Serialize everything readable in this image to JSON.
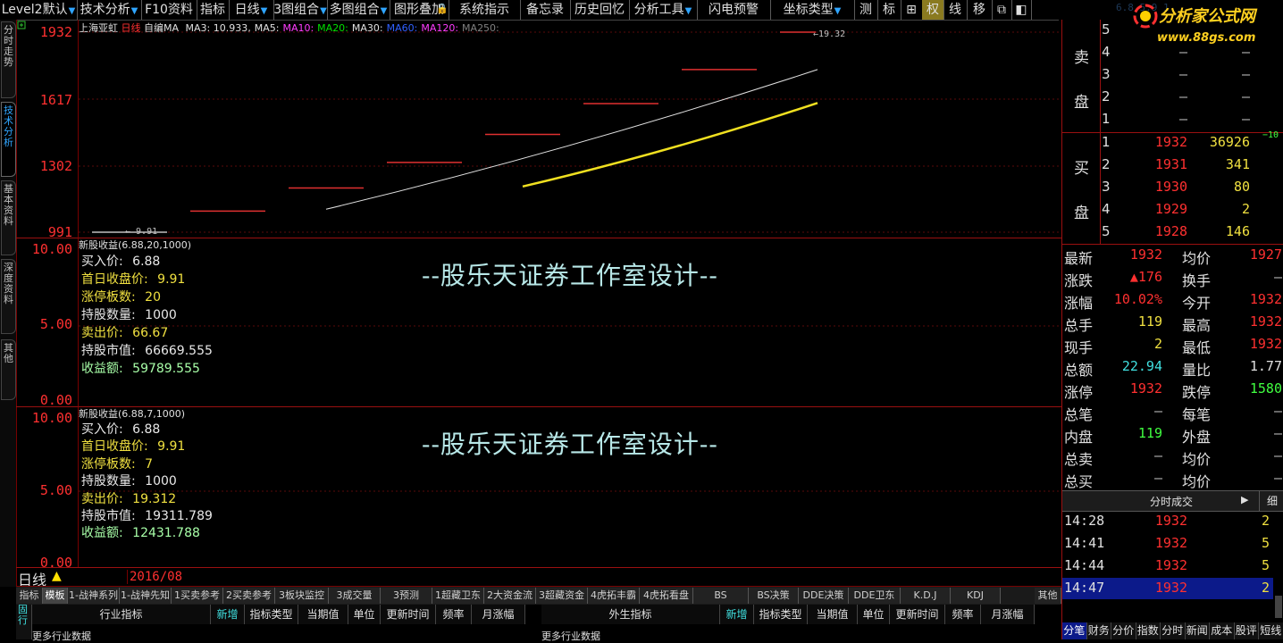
{
  "menu": [
    {
      "label": "Level2默认",
      "dropdown": true
    },
    {
      "label": "技术分析",
      "dropdown": true
    },
    {
      "label": "F10资料",
      "dropdown": false
    },
    {
      "label": "指标",
      "dropdown": false
    },
    {
      "label": "日线",
      "dropdown": true
    },
    {
      "label": "3图组合",
      "dropdown": true
    },
    {
      "label": "多图组合",
      "dropdown": true
    },
    {
      "label": "图形叠加",
      "dropdown": false
    },
    {
      "label": "系统指示",
      "dropdown": false
    },
    {
      "label": "备忘录",
      "dropdown": false
    },
    {
      "label": "历史回忆",
      "dropdown": false
    },
    {
      "label": "分析工具",
      "dropdown": true
    },
    {
      "label": "闪电预警",
      "dropdown": false
    },
    {
      "label": "坐标类型",
      "dropdown": true
    },
    {
      "label": "测",
      "dropdown": false
    },
    {
      "label": "标",
      "dropdown": false
    },
    {
      "label": "权",
      "dropdown": false
    },
    {
      "label": "线",
      "dropdown": false
    },
    {
      "label": "移",
      "dropdown": false
    }
  ],
  "logo": {
    "text": "分析家公式网",
    "url_text": "www.88gs.com",
    "faint": "6.8 5.9 1"
  },
  "left_tabs": [
    "分时走势",
    "技术分析",
    "基本资料",
    "深度资料",
    "其他"
  ],
  "main_chart": {
    "stock_name": "上海亚虹",
    "period": "日线",
    "ma_prefix": "自编MA",
    "ma_items": [
      {
        "label": "MA3: 10.933,",
        "color": "#e0e0e0"
      },
      {
        "label": "MA5:",
        "color": "#e0e0e0"
      },
      {
        "label": "MA10:",
        "color": "#ff3cff"
      },
      {
        "label": "MA20:",
        "color": "#00e000"
      },
      {
        "label": "MA30:",
        "color": "#e0e0e0"
      },
      {
        "label": "MA60:",
        "color": "#3060ff"
      },
      {
        "label": "MA120:",
        "color": "#ff3cff"
      },
      {
        "label": "MA250:",
        "color": "#808080"
      }
    ],
    "y_labels": [
      "1932",
      "1617",
      "1302",
      "991"
    ],
    "high_note": "←19.32",
    "low_note": "← 9.91"
  },
  "chart_data": {
    "type": "line",
    "title": "上海亚虹 日线",
    "ylabel": "",
    "ylim": [
      991,
      1932
    ],
    "x": [
      1,
      2,
      3,
      4,
      5,
      6,
      7,
      8
    ],
    "daily_price_levels": [
      991,
      1090,
      1199,
      1319,
      1451,
      1596,
      1756,
      1932
    ],
    "series": [
      {
        "name": "MA3",
        "color": "#e0e0e0",
        "x": [
          3,
          8
        ],
        "values": [
          1099,
          1756
        ]
      },
      {
        "name": "MA5",
        "color": "#f0e020",
        "x": [
          5,
          8
        ],
        "values": [
          1206,
          1599
        ]
      }
    ]
  },
  "sub1": {
    "title": "新股收益(6.88,20,1000)",
    "y_labels": [
      "10.00",
      "5.00",
      "0.00"
    ],
    "lines": [
      {
        "label": "买入价: ",
        "value": "6.88",
        "color": "#e8e8e8"
      },
      {
        "label": "首日收盘价: ",
        "value": "9.91",
        "color": "#f0e040"
      },
      {
        "label": "涨停板数: ",
        "value": "20",
        "color": "#f0e040"
      },
      {
        "label": "持股数量: ",
        "value": "1000",
        "color": "#e8e8e8"
      },
      {
        "label": "卖出价: ",
        "value": "66.67",
        "color": "#f0e040"
      },
      {
        "label": "持股市值: ",
        "value": "66669.555",
        "color": "#e8e8e8"
      },
      {
        "label": "收益额: ",
        "value": "59789.555",
        "color": "#a8ffa8"
      }
    ],
    "watermark": "--股乐天证券工作室设计--"
  },
  "sub2": {
    "title": "新股收益(6.88,7,1000)",
    "y_labels": [
      "10.00",
      "5.00",
      "0.00"
    ],
    "lines": [
      {
        "label": "买入价: ",
        "value": "6.88",
        "color": "#e8e8e8"
      },
      {
        "label": "首日收盘价: ",
        "value": "9.91",
        "color": "#f0e040"
      },
      {
        "label": "涨停板数: ",
        "value": "7",
        "color": "#f0e040"
      },
      {
        "label": "持股数量: ",
        "value": "1000",
        "color": "#e8e8e8"
      },
      {
        "label": "卖出价: ",
        "value": "19.312",
        "color": "#f0e040"
      },
      {
        "label": "持股市值: ",
        "value": "19311.789",
        "color": "#e8e8e8"
      },
      {
        "label": "收益额: ",
        "value": "12431.788",
        "color": "#a8ffa8"
      }
    ],
    "watermark": "--股乐天证券工作室设计--"
  },
  "xaxis": {
    "period": "日线",
    "date": "2016/08"
  },
  "order_book": {
    "sell_label": [
      "卖",
      "盘"
    ],
    "buy_label": [
      "买",
      "盘"
    ],
    "sells": [
      {
        "level": "5",
        "price": "",
        "vol": ""
      },
      {
        "level": "4",
        "price": "—",
        "vol": "—"
      },
      {
        "level": "3",
        "price": "—",
        "vol": "—"
      },
      {
        "level": "2",
        "price": "—",
        "vol": "—"
      },
      {
        "level": "1",
        "price": "—",
        "vol": "—"
      }
    ],
    "buys": [
      {
        "level": "1",
        "price": "1932",
        "vol": "36926",
        "extra": "−10"
      },
      {
        "level": "2",
        "price": "1931",
        "vol": "341",
        "extra": ""
      },
      {
        "level": "3",
        "price": "1930",
        "vol": "80",
        "extra": ""
      },
      {
        "level": "4",
        "price": "1929",
        "vol": "2",
        "extra": ""
      },
      {
        "level": "5",
        "price": "1928",
        "vol": "146",
        "extra": ""
      }
    ]
  },
  "quote": [
    {
      "k1": "最新",
      "v1": "1932",
      "c1": "#ff3030",
      "k2": "均价",
      "v2": "1927",
      "c2": "#ff3030"
    },
    {
      "k1": "涨跌",
      "v1": "▲176",
      "c1": "#ff3030",
      "k2": "换手",
      "v2": "—",
      "c2": "#c0c0c0"
    },
    {
      "k1": "涨幅",
      "v1": "10.02%",
      "c1": "#ff3030",
      "k2": "今开",
      "v2": "1932",
      "c2": "#ff3030"
    },
    {
      "k1": "总手",
      "v1": "119",
      "c1": "#f0e040",
      "k2": "最高",
      "v2": "1932",
      "c2": "#ff3030"
    },
    {
      "k1": "现手",
      "v1": "2",
      "c1": "#f0e040",
      "k2": "最低",
      "v2": "1932",
      "c2": "#ff3030"
    },
    {
      "k1": "总额",
      "v1": "22.94",
      "c1": "#40e0e0",
      "k2": "量比",
      "v2": "1.77",
      "c2": "#e0e0e0"
    },
    {
      "k1": "涨停",
      "v1": "1932",
      "c1": "#ff3030",
      "k2": "跌停",
      "v2": "1580",
      "c2": "#40ff40"
    },
    {
      "k1": "总笔",
      "v1": "—",
      "c1": "#c0c0c0",
      "k2": "每笔",
      "v2": "—",
      "c2": "#c0c0c0"
    },
    {
      "k1": "内盘",
      "v1": "119",
      "c1": "#40ff40",
      "k2": "外盘",
      "v2": "—",
      "c2": "#c0c0c0"
    },
    {
      "k1": "总卖",
      "v1": "—",
      "c1": "#c0c0c0",
      "k2": "均价",
      "v2": "—",
      "c2": "#c0c0c0"
    },
    {
      "k1": "总买",
      "v1": "—",
      "c1": "#c0c0c0",
      "k2": "均价",
      "v2": "—",
      "c2": "#c0c0c0"
    }
  ],
  "ticks": {
    "header": "分时成交",
    "detail_btn": "细",
    "rows": [
      {
        "time": "14:28",
        "price": "1932",
        "vol": "2"
      },
      {
        "time": "14:41",
        "price": "1932",
        "vol": "5"
      },
      {
        "time": "14:44",
        "price": "1932",
        "vol": "5"
      },
      {
        "time": "14:47",
        "price": "1932",
        "vol": "2"
      }
    ]
  },
  "bottom_right_tabs": [
    "分笔",
    "财务",
    "分价",
    "指数",
    "分时",
    "新闻",
    "成本",
    "股评",
    "短线"
  ],
  "formula_tabs": [
    "指标",
    "模板",
    "1-战神系列",
    "1-战神先知",
    "1买卖参考",
    "2买卖参考",
    "3板块监控",
    "3成交量",
    "3预测",
    "1超藏卫东",
    "2大资金流",
    "3超藏资金",
    "4虎拓丰霸",
    "4虎拓看盘",
    "BS",
    "BS决策",
    "DDE决策",
    "DDE卫东",
    "K.D.J",
    "KDJ",
    "其他"
  ],
  "bottom_left": {
    "side": "固行",
    "left_headers": [
      "行业指标",
      "新增",
      "指标类型",
      "当期值",
      "单位",
      "更新时间",
      "频率",
      "月涨幅"
    ],
    "right_headers": [
      "外生指标",
      "新增",
      "指标类型",
      "当期值",
      "单位",
      "更新时间",
      "频率",
      "月涨幅"
    ],
    "row_text_left": "更多行业数据",
    "row_text_right": "更多行业数据"
  }
}
